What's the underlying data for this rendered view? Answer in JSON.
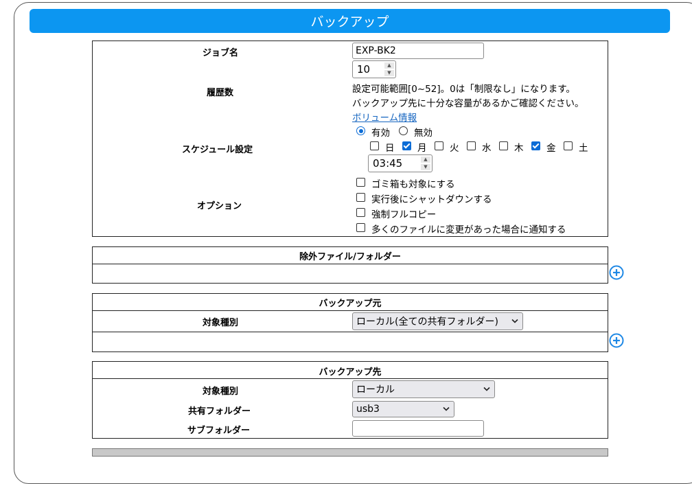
{
  "header": {
    "title": "バックアップ"
  },
  "job": {
    "name_label": "ジョブ名",
    "name_value": "EXP-BK2",
    "history_label": "履歴数",
    "history_value": "10",
    "history_note1": "設定可能範囲[0~52]。0は「制限なし」になります。",
    "history_note2": "バックアップ先に十分な容量があるかご確認ください。",
    "volume_link": "ボリューム情報",
    "schedule_label": "スケジュール設定",
    "schedule_enabled": "有効",
    "schedule_disabled": "無効",
    "days": [
      {
        "label": "日",
        "checked": false
      },
      {
        "label": "月",
        "checked": true
      },
      {
        "label": "火",
        "checked": false
      },
      {
        "label": "水",
        "checked": false
      },
      {
        "label": "木",
        "checked": false
      },
      {
        "label": "金",
        "checked": true
      },
      {
        "label": "土",
        "checked": false
      }
    ],
    "time_value": "03:45",
    "options_label": "オプション",
    "options": [
      {
        "label": "ゴミ箱も対象にする",
        "checked": false
      },
      {
        "label": "実行後にシャットダウンする",
        "checked": false
      },
      {
        "label": "強制フルコピー",
        "checked": false
      },
      {
        "label": "多くのファイルに変更があった場合に通知する",
        "checked": false
      }
    ]
  },
  "exclude": {
    "title": "除外ファイル/フォルダー"
  },
  "source": {
    "title": "バックアップ元",
    "type_label": "対象種別",
    "type_value": "ローカル(全ての共有フォルダー)"
  },
  "destination": {
    "title": "バックアップ先",
    "type_label": "対象種別",
    "type_value": "ローカル",
    "share_label": "共有フォルダー",
    "share_value": "usb3",
    "subfolder_label": "サブフォルダー",
    "subfolder_value": ""
  },
  "colors": {
    "accent": "#0c96f1",
    "check": "#0b6cd6",
    "plus": "#1e88e5"
  },
  "icons": {
    "add": "plus-circle-icon",
    "select": "chevron-down-icon"
  }
}
